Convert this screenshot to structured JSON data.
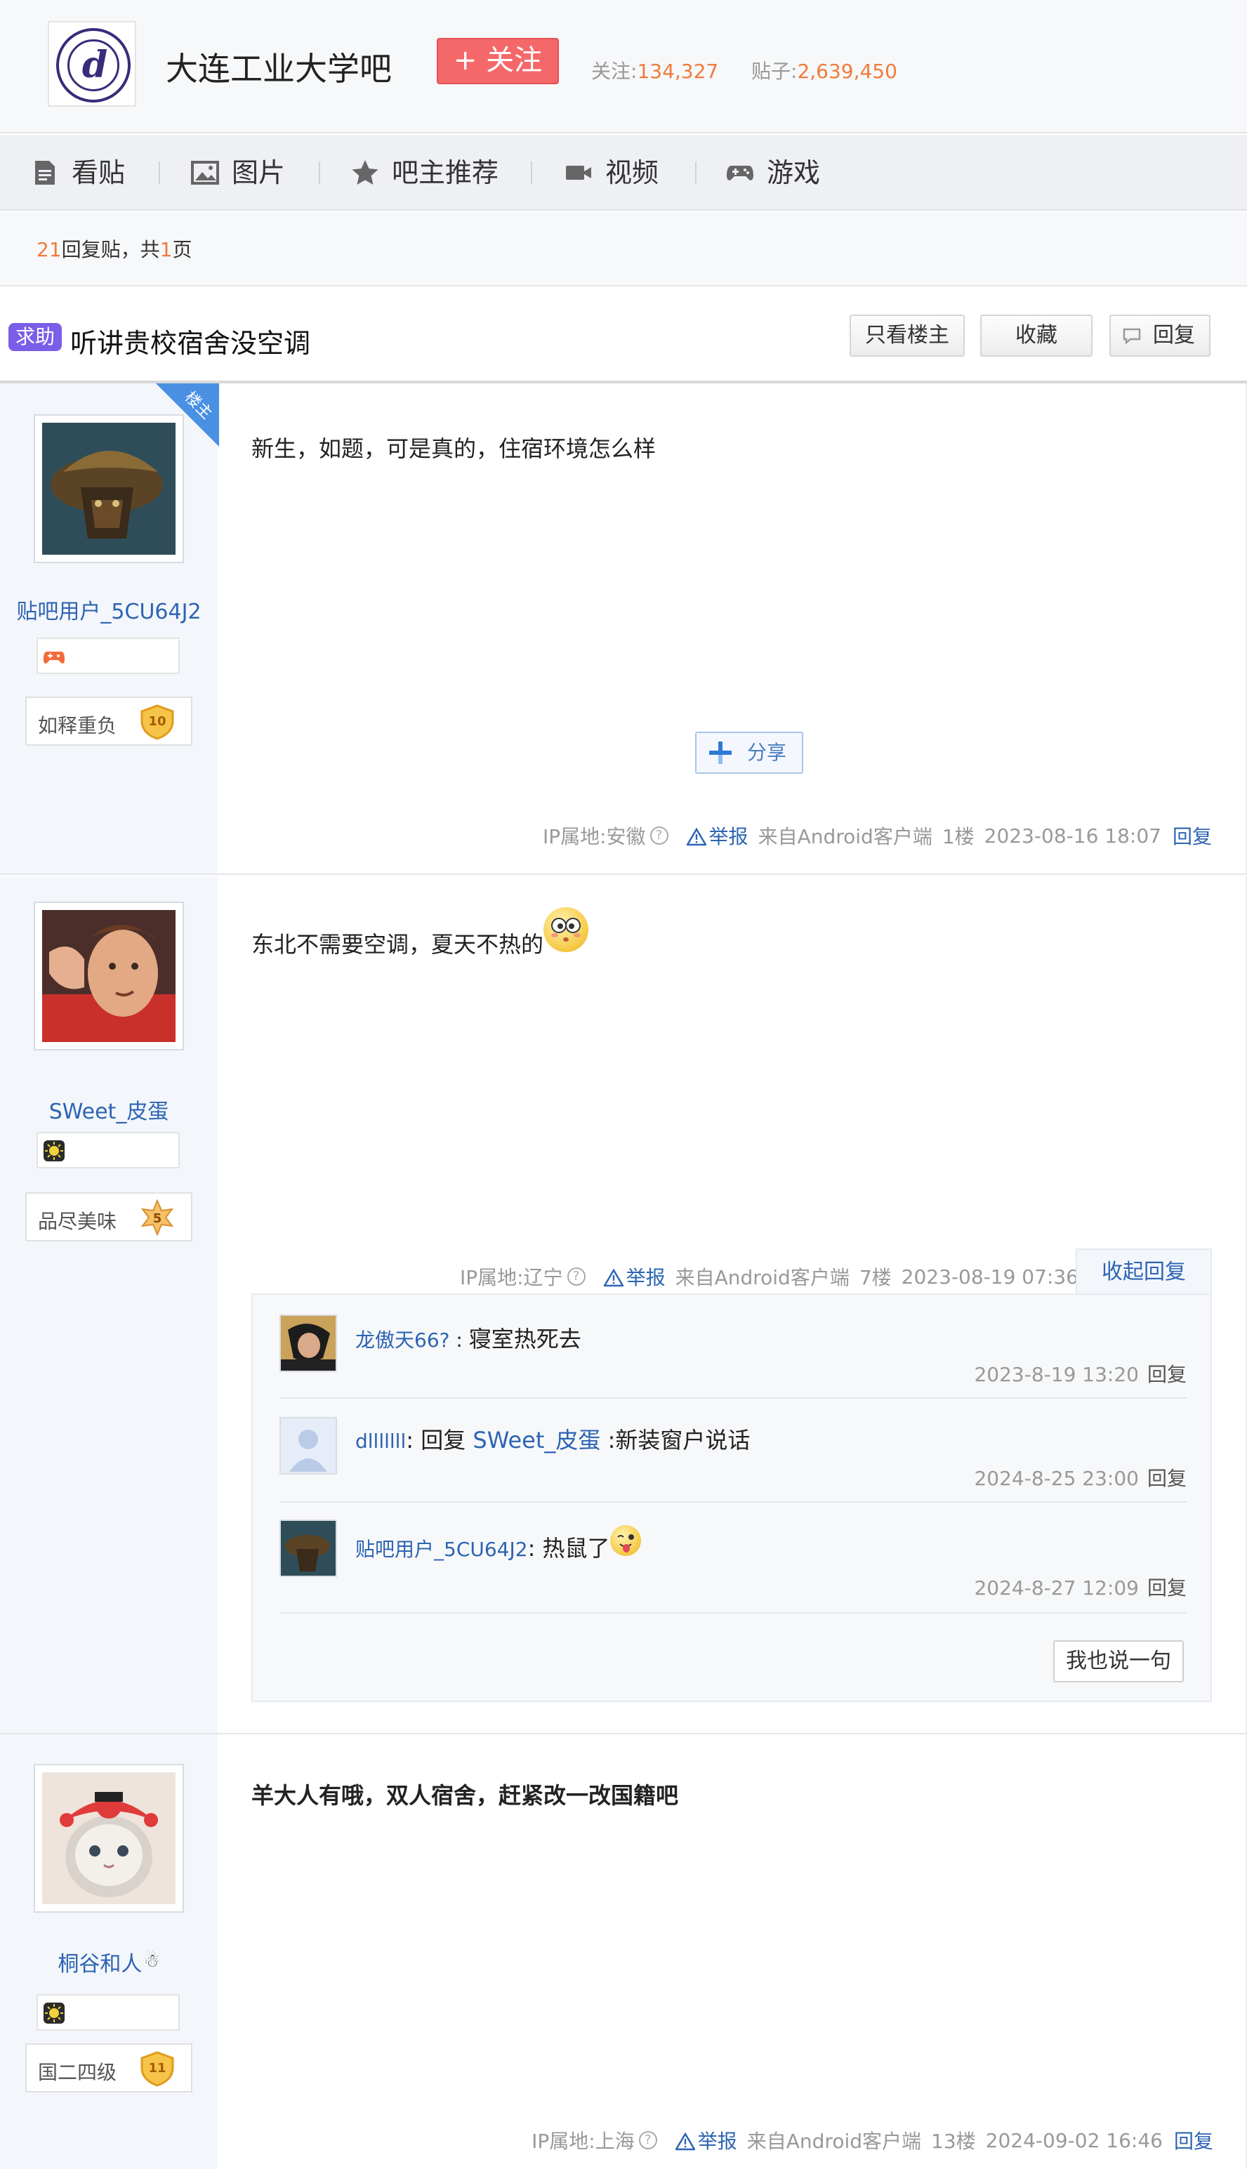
{
  "forum": {
    "name": "大连工业大学吧",
    "follow_label": "+ 关注",
    "followers_label": "关注:",
    "followers": "134,327",
    "posts_label": "贴子:",
    "posts": "2,639,450"
  },
  "nav": {
    "items": [
      {
        "label": "看贴",
        "icon": "document-icon"
      },
      {
        "label": "图片",
        "icon": "image-icon"
      },
      {
        "label": "吧主推荐",
        "icon": "star-icon"
      },
      {
        "label": "视频",
        "icon": "video-icon"
      },
      {
        "label": "游戏",
        "icon": "gamepad-icon"
      }
    ]
  },
  "reply_bar": {
    "count": "21",
    "text1": "回复贴，共",
    "pages": "1",
    "text2": "页"
  },
  "thread": {
    "tag": "求助",
    "title": "听讲贵校宿舍没空调",
    "buttons": {
      "only_owner": "只看楼主",
      "favorite": "收藏",
      "reply": "回复"
    }
  },
  "owner_label": "楼主",
  "share_label": "分享",
  "posts": [
    {
      "user": "贴吧用户_5CU64J2",
      "level_title": "如释重负",
      "level": "10",
      "content": "新生，如题，可是真的，住宿环境怎么样",
      "ip": "IP属地:安徽",
      "report": "举报",
      "source": "来自Android客户端",
      "floor": "1楼",
      "time": "2023-08-16 18:07",
      "reply": "回复"
    },
    {
      "user": "SWeet_皮蛋",
      "level_title": "品尽美味",
      "level": "5",
      "content": "东北不需要空调，夏天不热的",
      "ip": "IP属地:辽宁",
      "report": "举报",
      "source": "来自Android客户端",
      "floor": "7楼",
      "time": "2023-08-19 07:36",
      "collapse": "收起回复",
      "replies": [
        {
          "user": "龙傲天66?",
          "sep": " : ",
          "text": "寝室热死去",
          "time": "2023-8-19 13:20",
          "reply": "回复"
        },
        {
          "user": "dlllllll",
          "sep": ": 回复 ",
          "target": "SWeet_皮蛋",
          "text": " :新装窗户说话",
          "time": "2024-8-25 23:00",
          "reply": "回复"
        },
        {
          "user": "贴吧用户_5CU64J2",
          "sep": ": ",
          "text": "热鼠了",
          "time": "2024-8-27 12:09",
          "reply": "回复"
        }
      ],
      "say_btn": "我也说一句"
    },
    {
      "user": "桐谷和人",
      "level_title": "国二四级",
      "level": "11",
      "content": "羊大人有哦，双人宿舍，赶紧改一改国籍吧",
      "ip": "IP属地:上海",
      "report": "举报",
      "source": "来自Android客户端",
      "floor": "13楼",
      "time": "2024-09-02 16:46",
      "reply": "回复"
    }
  ],
  "colors": {
    "link": "#2d64b3",
    "accent": "#f07b3a",
    "follow": "#f4686a",
    "tag": "#7b5ee7"
  }
}
